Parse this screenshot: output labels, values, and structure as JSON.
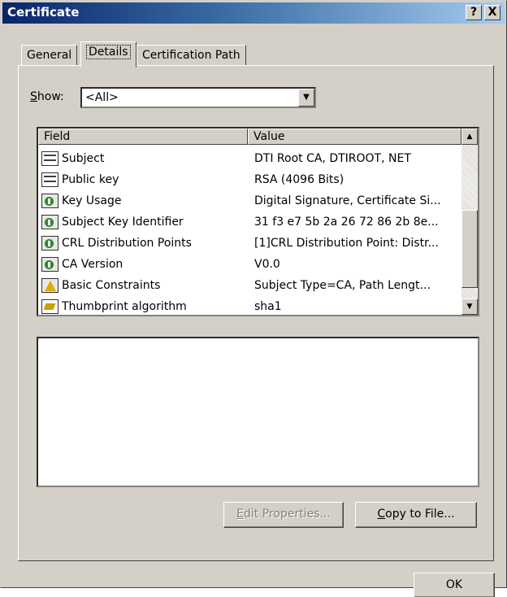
{
  "window": {
    "title": "Certificate",
    "help_glyph": "?",
    "close_glyph": "X"
  },
  "tabs": [
    {
      "label": "General"
    },
    {
      "label": "Details"
    },
    {
      "label": "Certification Path"
    }
  ],
  "show": {
    "label_mnemonic": "S",
    "label_rest": "how:",
    "selected": "<All>"
  },
  "list": {
    "columns": {
      "field": "Field",
      "value": "Value"
    },
    "rows": [
      {
        "icon": "cert-field-icon",
        "field": "Subject",
        "value": "DTI Root CA, DTIROOT, NET"
      },
      {
        "icon": "cert-field-icon",
        "field": "Public key",
        "value": "RSA (4096 Bits)"
      },
      {
        "icon": "extension-icon",
        "field": "Key Usage",
        "value": "Digital Signature, Certificate Si..."
      },
      {
        "icon": "extension-icon",
        "field": "Subject Key Identifier",
        "value": "31 f3 e7 5b 2a 26 72 86 2b 8e..."
      },
      {
        "icon": "extension-icon",
        "field": "CRL Distribution Points",
        "value": "[1]CRL Distribution Point: Distr..."
      },
      {
        "icon": "extension-icon",
        "field": "CA Version",
        "value": "V0.0"
      },
      {
        "icon": "critical-extension-icon",
        "field": "Basic Constraints",
        "value": "Subject Type=CA, Path Lengt..."
      },
      {
        "icon": "property-icon",
        "field": "Thumbprint algorithm",
        "value": "sha1"
      }
    ]
  },
  "buttons": {
    "edit_mnemonic": "E",
    "edit_rest": "dit Properties...",
    "copy_mnemonic": "C",
    "copy_rest": "opy to File...",
    "ok": "OK"
  },
  "colors": {
    "title_bar_start": "#0a246a",
    "title_bar_end": "#a6caf0",
    "face": "#d4d0c8"
  }
}
